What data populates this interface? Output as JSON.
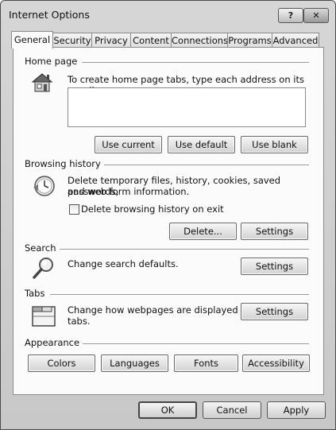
{
  "window": {
    "title": "Internet Options",
    "help_label": "?",
    "close_label": "✕"
  },
  "tabs": [
    {
      "label": "General",
      "active": true
    },
    {
      "label": "Security",
      "active": false
    },
    {
      "label": "Privacy",
      "active": false
    },
    {
      "label": "Content",
      "active": false
    },
    {
      "label": "Connections",
      "active": false
    },
    {
      "label": "Programs",
      "active": false
    },
    {
      "label": "Advanced",
      "active": false
    }
  ],
  "home_page": {
    "group_label": "Home page",
    "icon": "house-icon",
    "description": "To create home page tabs, type each address on its own line.",
    "textarea_value": "",
    "buttons": {
      "use_current": "Use current",
      "use_default": "Use default",
      "use_blank": "Use blank"
    }
  },
  "browsing_history": {
    "group_label": "Browsing history",
    "icon": "history-clock-icon",
    "description_line1": "Delete temporary files, history, cookies, saved passwords,",
    "description_line2": "and web form information.",
    "checkbox_label": "Delete browsing history on exit",
    "checkbox_checked": false,
    "buttons": {
      "delete": "Delete...",
      "settings": "Settings"
    }
  },
  "search": {
    "group_label": "Search",
    "icon": "magnifier-icon",
    "description": "Change search defaults.",
    "settings_label": "Settings"
  },
  "tabs_section": {
    "group_label": "Tabs",
    "icon": "tabs-window-icon",
    "description_line1": "Change how webpages are displayed in",
    "description_line2": "tabs.",
    "settings_label": "Settings"
  },
  "appearance": {
    "group_label": "Appearance",
    "buttons": {
      "colors": "Colors",
      "languages": "Languages",
      "fonts": "Fonts",
      "accessibility": "Accessibility"
    }
  },
  "dialog_buttons": {
    "ok": "OK",
    "cancel": "Cancel",
    "apply": "Apply"
  }
}
